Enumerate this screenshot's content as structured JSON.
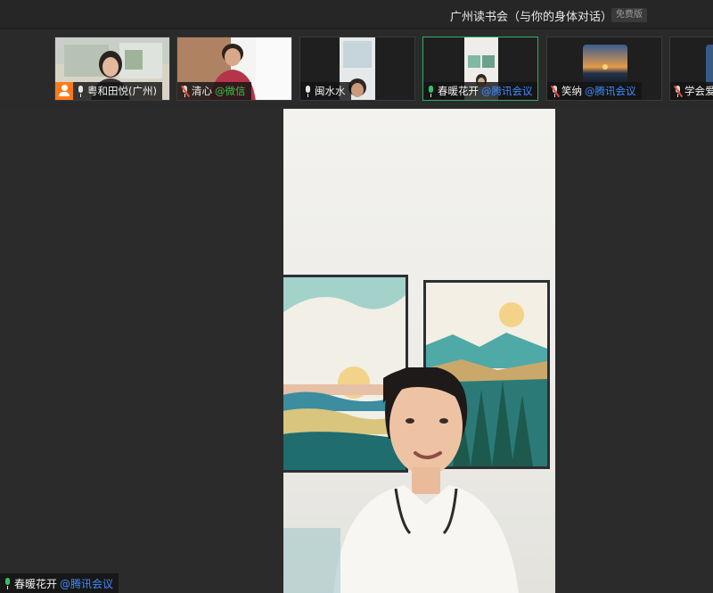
{
  "meeting": {
    "title": "广州读书会（与你的身体对话）",
    "edition_badge": "免费版"
  },
  "participants": [
    {
      "name": "粤和田悦(广州)",
      "source": "",
      "mic": "on",
      "host": true,
      "active": false
    },
    {
      "name": "清心",
      "source": "@微信",
      "mic": "muted",
      "host": false,
      "active": false
    },
    {
      "name": "闽水水",
      "source": "",
      "mic": "on",
      "host": false,
      "active": false
    },
    {
      "name": "春暖花开",
      "source": "@腾讯会议",
      "mic": "speaking",
      "host": false,
      "active": true
    },
    {
      "name": "笑纳",
      "source": "@腾讯会议",
      "mic": "muted",
      "host": false,
      "active": false
    },
    {
      "name": "学会爱",
      "source": "",
      "mic": "muted",
      "host": false,
      "active": false
    }
  ],
  "speaker": {
    "name": "春暖花开",
    "source": "@腾讯会议"
  },
  "colors": {
    "accent_green": "#2fae66",
    "tencent_blue": "#3d8bff",
    "wechat_green": "#39c14c",
    "host_orange": "#ff7a1a"
  }
}
